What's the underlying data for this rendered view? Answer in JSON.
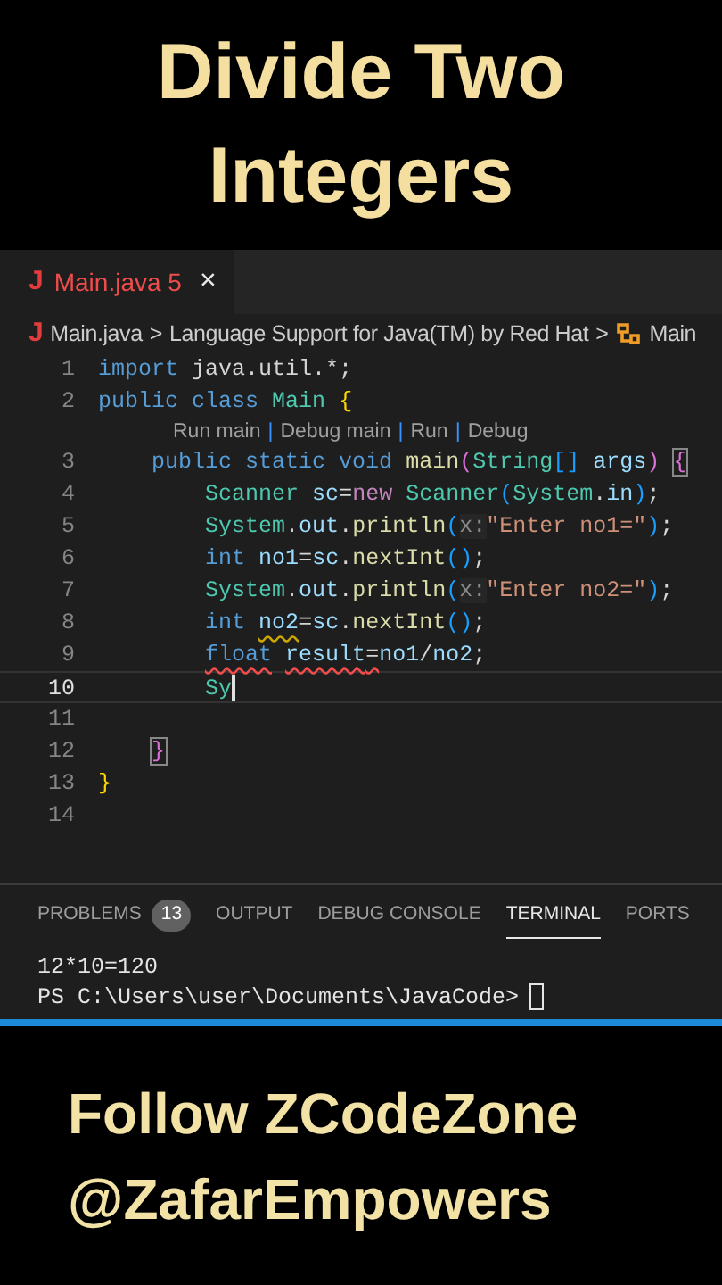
{
  "headline": [
    "Divide Two",
    "Integers"
  ],
  "editor_tab": {
    "file_icon": "J",
    "label": "Main.java",
    "problems": "5",
    "close": "×",
    "selected": true
  },
  "breadcrumb": [
    {
      "kind": "file",
      "icon": "J",
      "text": "Main.java"
    },
    {
      "kind": "sep",
      "text": ">"
    },
    {
      "kind": "text",
      "text": "Language Support for Java(TM) by Red Hat"
    },
    {
      "kind": "sep",
      "text": ">"
    },
    {
      "kind": "symbol",
      "text": "Main"
    }
  ],
  "code": [
    {
      "number": "1",
      "current": false,
      "tokens": [
        {
          "kind": "kw",
          "text": "import"
        },
        {
          "kind": "plain",
          "text": " java.util.*;"
        }
      ]
    },
    {
      "number": "2",
      "current": false,
      "tokens": [
        {
          "kind": "kw",
          "text": "public class"
        },
        {
          "kind": "type",
          "text": " Main"
        },
        {
          "kind": "b1",
          "text": " {"
        }
      ]
    },
    {
      "kind": "codelens",
      "parts": [
        {
          "kind": "link",
          "text": "Run main"
        },
        {
          "kind": "sep",
          "text": "|"
        },
        {
          "kind": "link",
          "text": "Debug main"
        },
        {
          "kind": "sep",
          "text": "|"
        },
        {
          "kind": "link",
          "text": "Run"
        },
        {
          "kind": "sep",
          "text": "|"
        },
        {
          "kind": "link",
          "text": "Debug"
        }
      ]
    },
    {
      "number": "3",
      "current": false,
      "tokens": [
        {
          "kind": "kw",
          "text": "    public static void"
        },
        {
          "kind": "fn",
          "text": " main"
        },
        {
          "kind": "b2",
          "text": "("
        },
        {
          "kind": "type",
          "text": "String"
        },
        {
          "kind": "b3",
          "text": "[]"
        },
        {
          "kind": "var",
          "text": " args"
        },
        {
          "kind": "b2",
          "text": ")"
        },
        {
          "kind": "b2",
          "text": " {",
          "boxed": true
        }
      ]
    },
    {
      "number": "4",
      "current": false,
      "tokens": [
        {
          "kind": "type",
          "text": "        Scanner"
        },
        {
          "kind": "var",
          "text": " sc"
        },
        {
          "kind": "plain",
          "text": "="
        },
        {
          "kind": "ctl",
          "text": "new"
        },
        {
          "kind": "type",
          "text": " Scanner"
        },
        {
          "kind": "b3",
          "text": "("
        },
        {
          "kind": "type",
          "text": "System"
        },
        {
          "kind": "plain",
          "text": "."
        },
        {
          "kind": "var",
          "text": "in"
        },
        {
          "kind": "b3",
          "text": ")"
        },
        {
          "kind": "plain",
          "text": ";"
        }
      ]
    },
    {
      "number": "5",
      "current": false,
      "tokens": [
        {
          "kind": "type",
          "text": "        System"
        },
        {
          "kind": "plain",
          "text": "."
        },
        {
          "kind": "var",
          "text": "out"
        },
        {
          "kind": "plain",
          "text": "."
        },
        {
          "kind": "fn",
          "text": "println"
        },
        {
          "kind": "b3",
          "text": "("
        },
        {
          "kind": "hint",
          "text": "x:"
        },
        {
          "kind": "str",
          "text": "\"Enter no1=\""
        },
        {
          "kind": "b3",
          "text": ")"
        },
        {
          "kind": "plain",
          "text": ";"
        }
      ]
    },
    {
      "number": "6",
      "current": false,
      "tokens": [
        {
          "kind": "kw",
          "text": "        int"
        },
        {
          "kind": "var",
          "text": " no1"
        },
        {
          "kind": "plain",
          "text": "="
        },
        {
          "kind": "var",
          "text": "sc"
        },
        {
          "kind": "plain",
          "text": "."
        },
        {
          "kind": "fn",
          "text": "nextInt"
        },
        {
          "kind": "b3",
          "text": "()"
        },
        {
          "kind": "plain",
          "text": ";"
        }
      ]
    },
    {
      "number": "7",
      "current": false,
      "tokens": [
        {
          "kind": "type",
          "text": "        System"
        },
        {
          "kind": "plain",
          "text": "."
        },
        {
          "kind": "var",
          "text": "out"
        },
        {
          "kind": "plain",
          "text": "."
        },
        {
          "kind": "fn",
          "text": "println"
        },
        {
          "kind": "b3",
          "text": "("
        },
        {
          "kind": "hint",
          "text": "x:"
        },
        {
          "kind": "str",
          "text": "\"Enter no2=\""
        },
        {
          "kind": "b3",
          "text": ")"
        },
        {
          "kind": "plain",
          "text": ";"
        }
      ]
    },
    {
      "number": "8",
      "current": false,
      "tokens": [
        {
          "kind": "kw",
          "text": "        int"
        },
        {
          "kind": "var",
          "text": " no2",
          "warning": true
        },
        {
          "kind": "plain",
          "text": "="
        },
        {
          "kind": "var",
          "text": "sc"
        },
        {
          "kind": "plain",
          "text": "."
        },
        {
          "kind": "fn",
          "text": "nextInt"
        },
        {
          "kind": "b3",
          "text": "()"
        },
        {
          "kind": "plain",
          "text": ";"
        }
      ]
    },
    {
      "number": "9",
      "current": false,
      "tokens": [
        {
          "kind": "kw",
          "text": "        float",
          "error": true
        },
        {
          "kind": "var",
          "text": " result",
          "error": true
        },
        {
          "kind": "plain",
          "text": "=",
          "error": true
        },
        {
          "kind": "var",
          "text": "no1"
        },
        {
          "kind": "plain",
          "text": "/"
        },
        {
          "kind": "var",
          "text": "no2"
        },
        {
          "kind": "plain",
          "text": ";"
        }
      ]
    },
    {
      "number": "10",
      "current": true,
      "tokens": [
        {
          "kind": "type",
          "text": "        Sy"
        }
      ]
    },
    {
      "number": "11",
      "current": false
    },
    {
      "number": "12",
      "current": false,
      "tokens": [
        {
          "kind": "b2",
          "text": "    }",
          "boxed": true
        }
      ]
    },
    {
      "number": "13",
      "current": false,
      "tokens": [
        {
          "kind": "b1",
          "text": "}"
        }
      ]
    },
    {
      "number": "14",
      "current": false
    }
  ],
  "panel_tabs": [
    {
      "label": "PROBLEMS",
      "count": "13",
      "selected": false
    },
    {
      "label": "OUTPUT",
      "selected": false
    },
    {
      "label": "DEBUG CONSOLE",
      "selected": false
    },
    {
      "label": "TERMINAL",
      "selected": true
    },
    {
      "label": "PORTS",
      "selected": false
    }
  ],
  "terminal": [
    "12*10=120",
    "PS C:\\Users\\user\\Documents\\JavaCode>"
  ],
  "footer": [
    "Follow ZCodeZone",
    "@ZafarEmpowers"
  ]
}
